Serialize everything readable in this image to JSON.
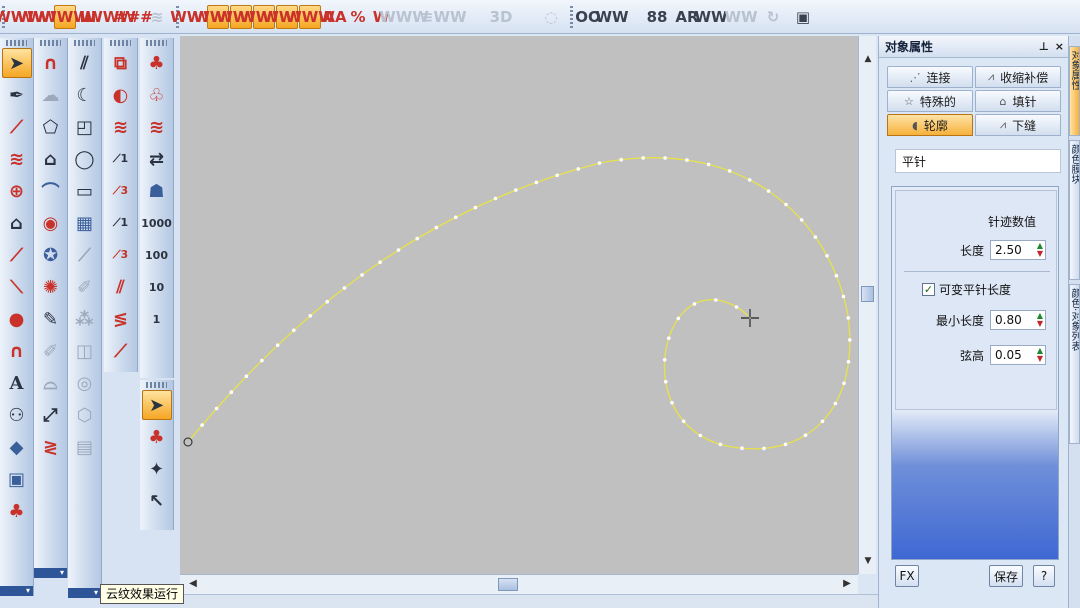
{
  "toolbar": {
    "buttons": [
      "WWW",
      "WWW",
      "WWW",
      "III",
      "WWW",
      "###",
      "≋",
      "WWW",
      "WWW",
      "WWW",
      "WWW",
      "WWW",
      "WWW",
      "AA",
      "%",
      "W",
      "WWW",
      "≡",
      "WW",
      "3D",
      "◌",
      "OO",
      "WW",
      "88",
      "AR",
      "WW",
      "WW",
      "↻",
      "▣"
    ]
  },
  "palettes": {
    "col1": [
      "arrow-select",
      "pen-tool",
      "knife",
      "zigzag",
      "applique",
      "stars-tool",
      "line-run",
      "line-run-1",
      "ball-red",
      "arch",
      "A",
      "people",
      "diamond",
      "frame",
      "mushroom",
      "fan"
    ],
    "col2": [
      "horseshoe",
      "ghost",
      "polygon",
      "house",
      "pipe",
      "sphere",
      "star",
      "wheel",
      "pen",
      "pencil",
      "wave",
      "tongs",
      "letter-z"
    ],
    "col3": [
      "parallel",
      "crescent",
      "shape-corner",
      "ellipse",
      "rectangle",
      "grid",
      "diag",
      "pin",
      "dots",
      "square-spiral",
      "oc",
      "hexagon",
      "maze"
    ],
    "col4": [
      "film",
      "half-circle",
      "zigzag-r",
      "line-1",
      "line-3",
      "line-2",
      "line-4",
      "red-diag",
      "red-zz",
      "red-diag2"
    ],
    "col5": [
      "tree",
      "tree2",
      "zigzag",
      "arrows",
      "figure",
      "1000",
      "100",
      "10",
      "1",
      "select",
      "clover",
      "wand",
      "pointer"
    ]
  },
  "panel": {
    "title": "对象属性",
    "pin": "⊥",
    "close": "×",
    "tabs": [
      [
        "连接",
        "收缩补偿"
      ],
      [
        "特殊的",
        "填针"
      ],
      [
        "轮廓",
        "下缝"
      ]
    ],
    "stitch_type": "平针",
    "props_title": "针迹数值",
    "length_label": "长度",
    "length_value": "2.50",
    "variable_label": "可变平针长度",
    "min_length_label": "最小长度",
    "min_length_value": "0.80",
    "chord_label": "弦高",
    "chord_value": "0.05",
    "fx_label": "FX",
    "save_label": "保存",
    "help_label": "?",
    "side_tabs": [
      "对象属性",
      "颜色膜块",
      "颜色·对象列表"
    ]
  },
  "tooltip": "云纹效果运行",
  "colors": {
    "curve": "#e8e24a",
    "canvas": "#c0c0c0",
    "accent": "#f5a623"
  }
}
